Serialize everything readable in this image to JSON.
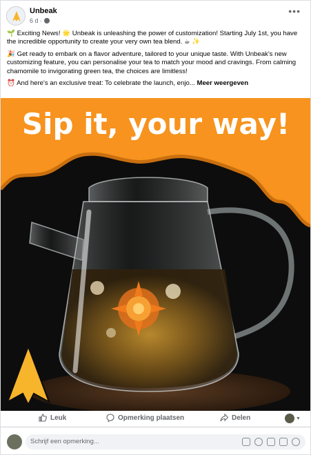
{
  "post": {
    "page_name": "Unbeak",
    "time": "6 d ·",
    "paragraph1": "🌱 Exciting News! 🌟 Unbeak is unleashing the power of customization! Starting July 1st, you have the incredible opportunity to create your very own tea blend. ☕ ✨",
    "paragraph2": "🎉 Get ready to embark on a flavor adventure, tailored to your unique taste. With Unbeak's new customizing feature, you can personalise your tea to match your mood and cravings. From calming chamomile to invigorating green tea, the choices are limitless!",
    "paragraph3_prefix": "⏰ And here's an exclusive treat: To celebrate the launch, enjo...",
    "see_more": "Meer weergeven"
  },
  "image": {
    "headline": "Sip it, your way!",
    "orange": "#f7931e",
    "dark": "#0d0d0d"
  },
  "actions": {
    "like": "Leuk",
    "comment": "Opmerking plaatsen",
    "share": "Delen"
  },
  "comment": {
    "placeholder": "Schrijf een opmerking..."
  },
  "icons": [
    "more-icon",
    "globe-icon",
    "like-icon",
    "comment-icon",
    "share-icon",
    "sticker-icon",
    "emoji-icon",
    "camera-icon",
    "gif-icon",
    "stamp-icon"
  ]
}
